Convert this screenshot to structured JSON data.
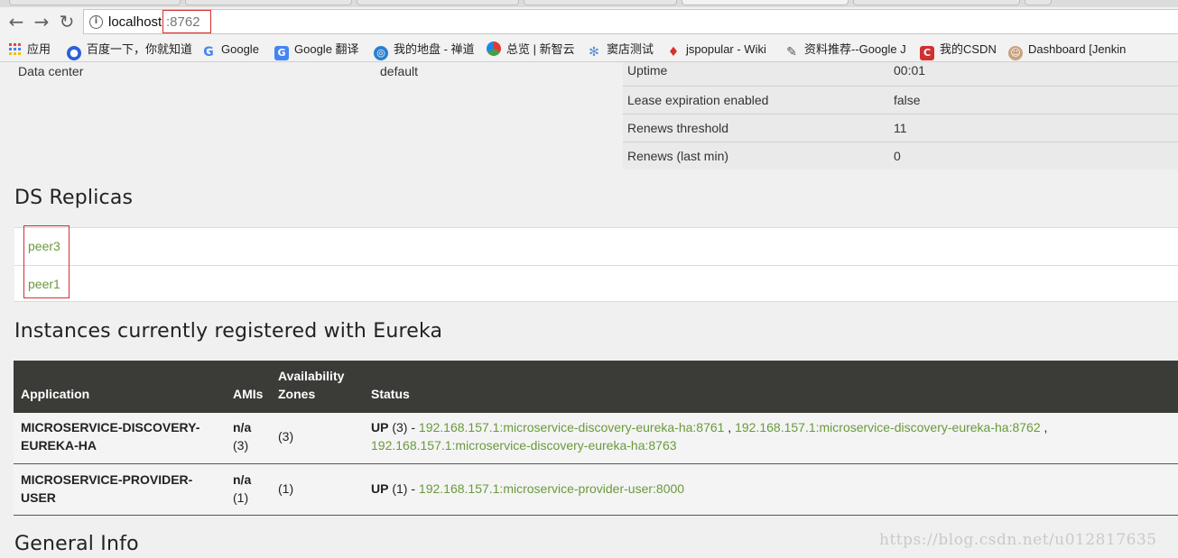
{
  "browser": {
    "back_glyph": "←",
    "forward_glyph": "→",
    "reload_glyph": "↻",
    "info_glyph": "i",
    "address_host": "localhost",
    "address_port": ":8762",
    "bookmarks": [
      {
        "icon": "apps-grid-icon",
        "label": "应用"
      },
      {
        "icon": "baidu-paw-icon",
        "label": "百度一下，你就知道"
      },
      {
        "icon": "google-g-icon",
        "label": "Google"
      },
      {
        "icon": "google-translate-icon",
        "label": "Google 翻译"
      },
      {
        "icon": "globe-icon",
        "label": "我的地盘 - 禅道"
      },
      {
        "icon": "circle-logo-icon",
        "label": "总览 | 新智云"
      },
      {
        "icon": "snowflake-icon",
        "label": "窦店测试"
      },
      {
        "icon": "map-pin-icon",
        "label": "jspopular - Wiki"
      },
      {
        "icon": "scroll-icon",
        "label": "资料推荐--Google J"
      },
      {
        "icon": "csdn-c-icon",
        "label": "我的CSDN"
      },
      {
        "icon": "jenkins-butler-icon",
        "label": "Dashboard [Jenkin"
      }
    ]
  },
  "env": {
    "datacenter_label": "Data center",
    "datacenter_value": "default"
  },
  "status_info": [
    {
      "label": "Uptime",
      "value": "00:01"
    },
    {
      "label": "Lease expiration enabled",
      "value": "false"
    },
    {
      "label": "Renews threshold",
      "value": "11"
    },
    {
      "label": "Renews (last min)",
      "value": "0"
    }
  ],
  "replicas": {
    "heading": "DS Replicas",
    "items": [
      "peer3",
      "peer1"
    ]
  },
  "instances": {
    "heading": "Instances currently registered with Eureka",
    "columns": {
      "application": "Application",
      "amis": "AMIs",
      "zones_line1": "Availability",
      "zones_line2": "Zones",
      "status": "Status"
    },
    "rows": [
      {
        "app_line1": "MICROSERVICE-DISCOVERY-",
        "app_line2": "EUREKA-HA",
        "amis_main": "n/a",
        "amis_count": "(3)",
        "zones": "(3)",
        "status_word": "UP",
        "status_count": " (3) - ",
        "links": [
          "192.168.157.1:microservice-discovery-eureka-ha:8761",
          "192.168.157.1:microservice-discovery-eureka-ha:8762",
          "192.168.157.1:microservice-discovery-eureka-ha:8763"
        ],
        "sep": " , "
      },
      {
        "app_line1": "MICROSERVICE-PROVIDER-",
        "app_line2": "USER",
        "amis_main": "n/a",
        "amis_count": "(1)",
        "zones": "(1)",
        "status_word": "UP",
        "status_count": " (1) - ",
        "links": [
          "192.168.157.1:microservice-provider-user:8000"
        ]
      }
    ]
  },
  "general": {
    "heading": "General Info"
  },
  "watermark": "https://blog.csdn.net/u012817635",
  "colors": {
    "link_green": "#6a9a3c",
    "table_header_bg": "#3b3b37",
    "highlight_red": "#d32f2f"
  }
}
